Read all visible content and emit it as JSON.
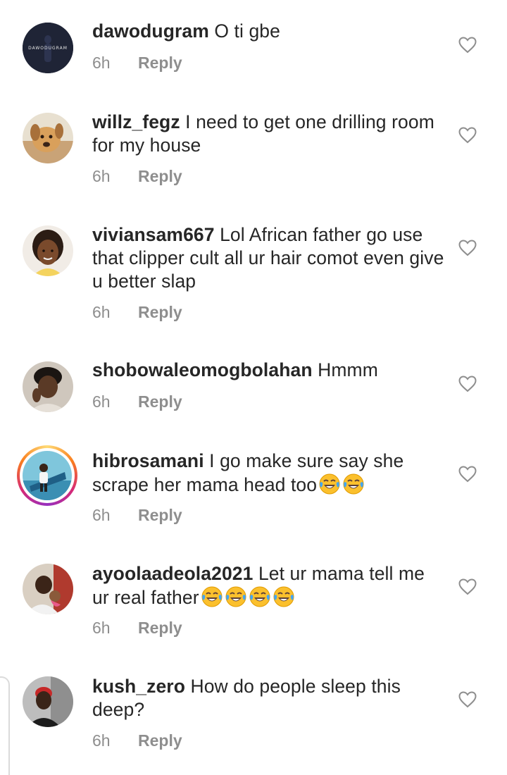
{
  "comments": [
    {
      "username": "dawodugram",
      "text": "O ti gbe",
      "time": "6h",
      "reply": "Reply",
      "avatar_label": "DAWODUGRAM"
    },
    {
      "username": "willz_fegz",
      "text": "I need to get one drilling room for my house",
      "time": "6h",
      "reply": "Reply"
    },
    {
      "username": "viviansam667",
      "text": "Lol African father go use that clipper cult all ur hair comot even give u better slap",
      "time": "6h",
      "reply": "Reply"
    },
    {
      "username": "shobowaleomogbolahan",
      "text": "Hmmm",
      "time": "6h",
      "reply": "Reply"
    },
    {
      "username": "hibrosamani",
      "text": "I go make sure say she scrape her mama head too",
      "time": "6h",
      "reply": "Reply"
    },
    {
      "username": "ayoolaadeola2021",
      "text": "Let ur mama tell me ur real father",
      "time": "6h",
      "reply": "Reply"
    },
    {
      "username": "kush_zero",
      "text": "How do people sleep this deep?",
      "time": "6h",
      "reply": "Reply"
    }
  ],
  "icons": {
    "like": "heart-outline-icon",
    "emoji": "tears-of-joy-emoji"
  },
  "colors": {
    "text": "#262626",
    "meta": "#8e8e8e",
    "heart": "#8e8e8e"
  }
}
